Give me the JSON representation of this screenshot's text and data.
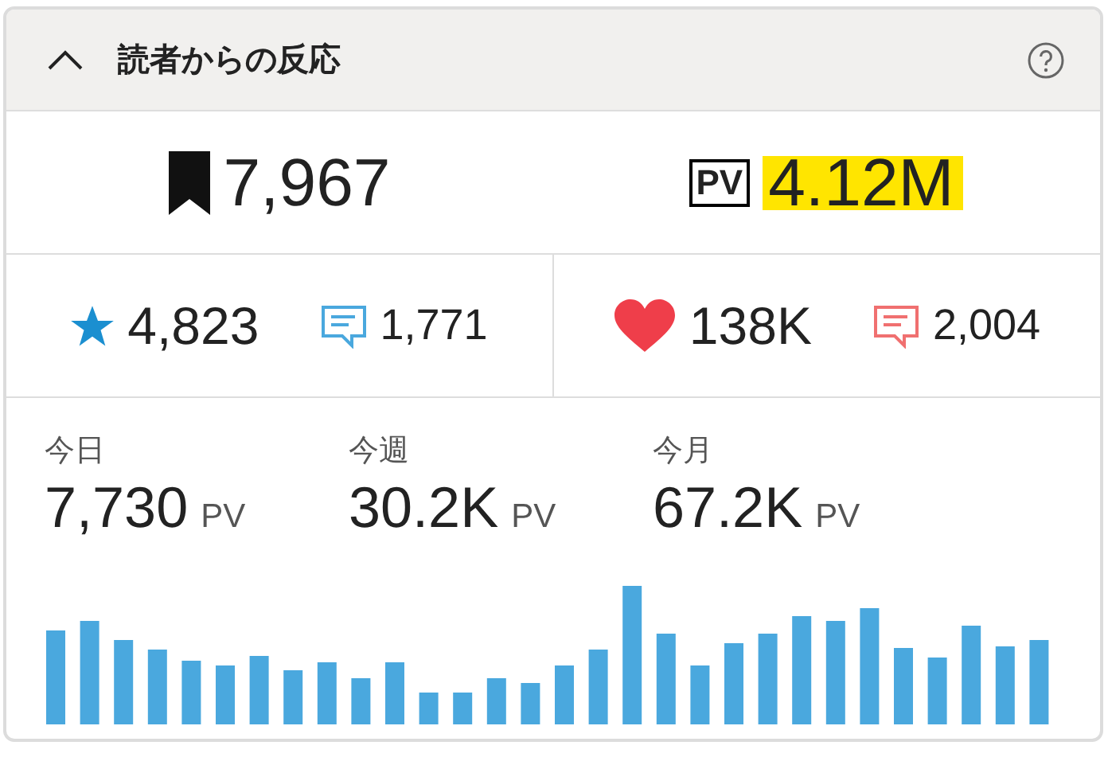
{
  "panel": {
    "title": "読者からの反応",
    "expanded": true
  },
  "totals": {
    "bookmarks": "7,967",
    "pageviews": "4.12M"
  },
  "stats": [
    {
      "kind": "star",
      "count": "4,823",
      "comments": "1,771"
    },
    {
      "kind": "heart",
      "count": "138K",
      "comments": "2,004"
    }
  ],
  "periods": [
    {
      "label": "今日",
      "value": "7,730",
      "unit": "PV"
    },
    {
      "label": "今週",
      "value": "30.2K",
      "unit": "PV"
    },
    {
      "label": "今月",
      "value": "67.2K",
      "unit": "PV"
    }
  ],
  "pv_badge": "PV"
}
